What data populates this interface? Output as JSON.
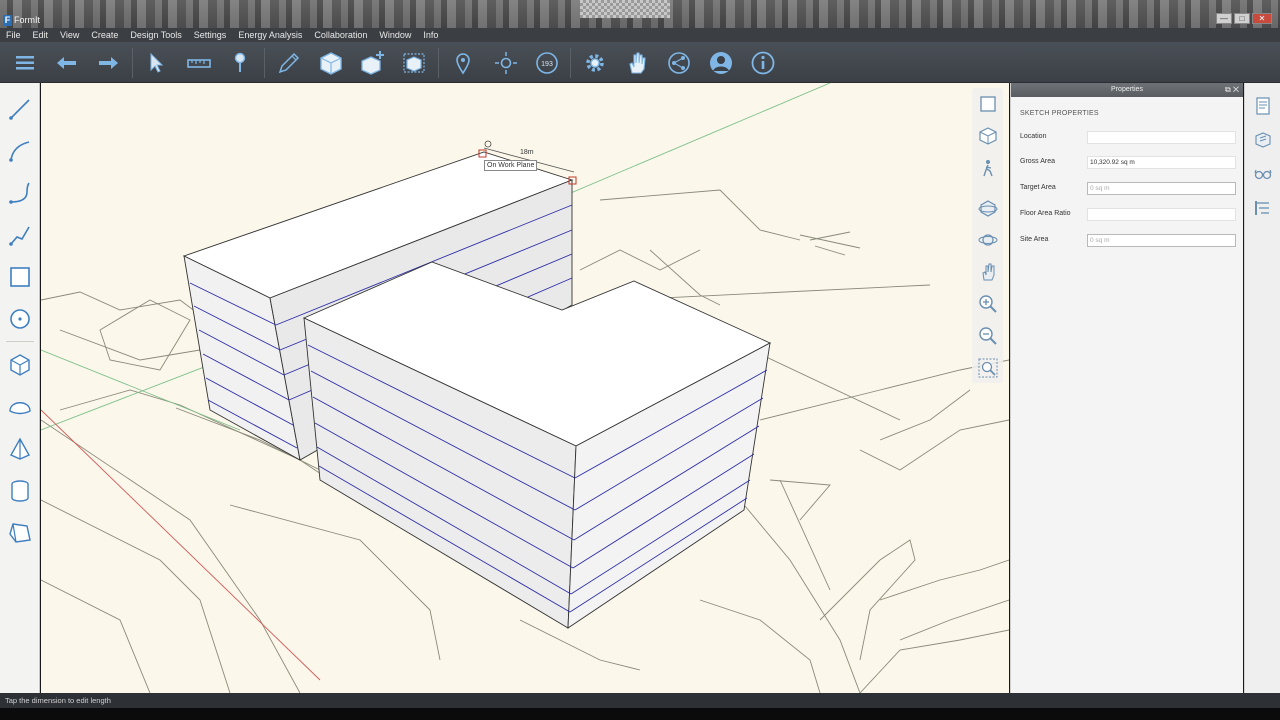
{
  "window": {
    "app_icon": "F",
    "title": "FormIt"
  },
  "window_controls": {
    "minimize": "—",
    "maximize": "□",
    "close": "✕"
  },
  "menu": [
    "File",
    "Edit",
    "View",
    "Create",
    "Design Tools",
    "Settings",
    "Energy Analysis",
    "Collaboration",
    "Window",
    "Info"
  ],
  "toolbar": {
    "icons": [
      "menu-icon",
      "undo-icon",
      "redo-icon",
      "select-icon",
      "measure-icon",
      "pushpull-icon",
      "pencil-icon",
      "cube-icon",
      "cube-add-icon",
      "cube-group-icon",
      "location-pin-icon",
      "sun-icon",
      "level-icon",
      "gear-icon",
      "hand-icon",
      "share-icon",
      "user-icon",
      "info-icon"
    ],
    "level_badge": "193"
  },
  "left_tools": [
    "line-icon",
    "arc-icon",
    "spline-icon",
    "polyline-icon",
    "rectangle-icon",
    "circle-icon",
    "box-icon",
    "dome-icon",
    "pyramid-icon",
    "cylinder-icon",
    "prism-icon"
  ],
  "nav_tools": [
    "view-cube-front-icon",
    "view-cube-iso-icon",
    "walk-icon",
    "orbit-icon",
    "look-around-icon",
    "pan-icon",
    "zoom-in-icon",
    "zoom-out-icon",
    "zoom-extents-icon"
  ],
  "viewport": {
    "dimension_label": "18m",
    "snap_tooltip": "On Work Plane"
  },
  "properties": {
    "panel_title": "Properties",
    "section_title": "SKETCH PROPERTIES",
    "fields": [
      {
        "label": "Location",
        "value": ""
      },
      {
        "label": "Gross Area",
        "value": "10,320.92 sq m"
      },
      {
        "label": "Target Area",
        "value": "0 sq m"
      },
      {
        "label": "Floor Area Ratio",
        "value": ""
      },
      {
        "label": "Site Area",
        "value": "0 sq m"
      }
    ]
  },
  "right_tools": [
    "properties-icon",
    "materials-icon",
    "layers-glasses-icon",
    "levels-icon"
  ],
  "status": {
    "message": "Tap the dimension to edit length"
  }
}
